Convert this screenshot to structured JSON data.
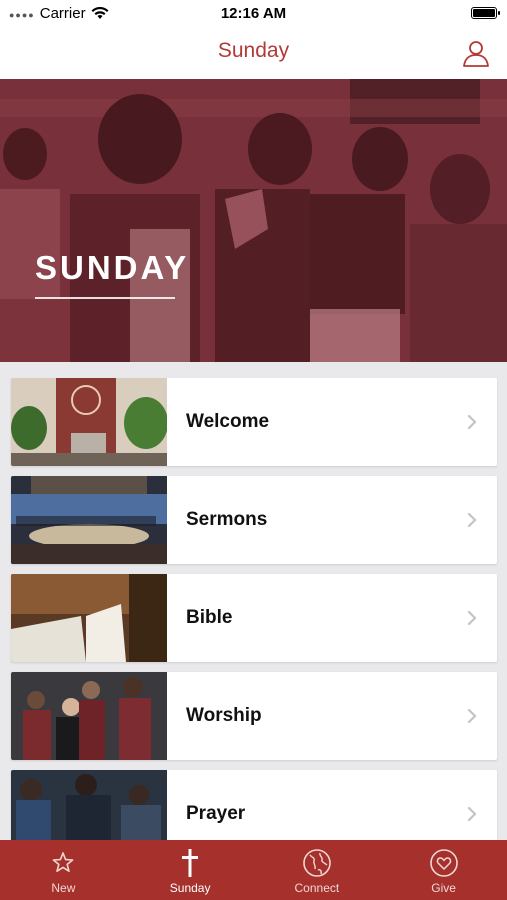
{
  "status_bar": {
    "carrier": "Carrier",
    "time": "12:16 AM"
  },
  "nav": {
    "title": "Sunday",
    "profile_icon": "person-icon"
  },
  "hero": {
    "heading": "SUNDAY"
  },
  "list": [
    {
      "label": "Welcome",
      "thumb_icon": "church-sign-image"
    },
    {
      "label": "Sermons",
      "thumb_icon": "stage-image"
    },
    {
      "label": "Bible",
      "thumb_icon": "open-bible-image"
    },
    {
      "label": "Worship",
      "thumb_icon": "singers-image"
    },
    {
      "label": "Prayer",
      "thumb_icon": "praying-people-image"
    }
  ],
  "tabs": [
    {
      "label": "New",
      "icon": "star-icon"
    },
    {
      "label": "Sunday",
      "icon": "cross-icon",
      "active": true
    },
    {
      "label": "Connect",
      "icon": "globe-icon"
    },
    {
      "label": "Give",
      "icon": "heart-icon"
    }
  ],
  "colors": {
    "accent": "#b23a36",
    "tabbar": "#a5302c",
    "hero_tint": "#7d3a40"
  }
}
